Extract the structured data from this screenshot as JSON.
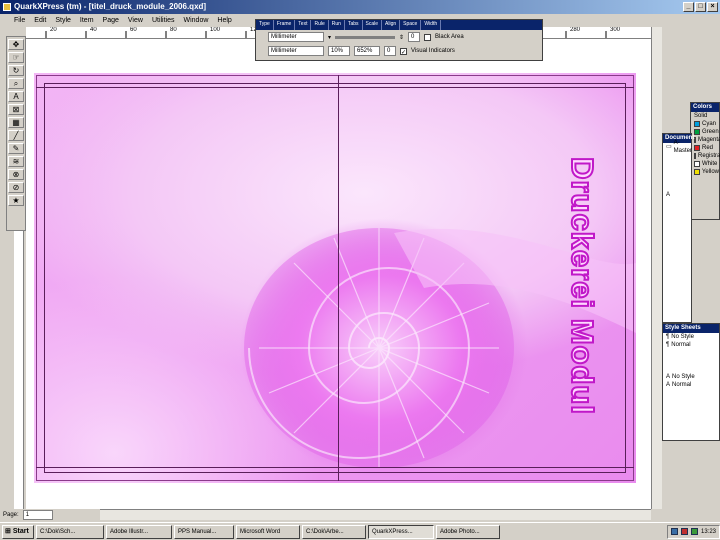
{
  "window": {
    "title": "QuarkXPress (tm) - [titel_druck_module_2006.qxd]"
  },
  "menubar": [
    "File",
    "Edit",
    "Style",
    "Item",
    "Page",
    "View",
    "Utilities",
    "Window",
    "Help"
  ],
  "ruler": {
    "ticks": [
      "20",
      "40",
      "60",
      "80",
      "100",
      "120",
      "140",
      "160",
      "180",
      "200",
      "220",
      "240",
      "260",
      "280",
      "300"
    ]
  },
  "measurements": {
    "tabs": [
      "Type",
      "Frame",
      "Text",
      "Rule",
      "Run",
      "Tabs",
      "Scale",
      "Align",
      "Space",
      "Width"
    ],
    "row1": {
      "unit_a": "Millimeter",
      "check_a_label": "Black Area",
      "value_b": "0"
    },
    "row2": {
      "unit_b": "Millimeter",
      "zoom_a": "10%",
      "zoom_b": "652%",
      "value_c": "0",
      "check_b_label": "Visual Indicators"
    }
  },
  "document": {
    "vertical_text": "Druckerei Modul"
  },
  "status": {
    "page_label": "Page:",
    "page_value": "1"
  },
  "colors_palette": {
    "title": "Colors",
    "mode": "Solid",
    "items": [
      {
        "name": "Cyan",
        "color": "#00a0e0"
      },
      {
        "name": "Green",
        "color": "#00a040"
      },
      {
        "name": "Magenta",
        "color": "#d0108a"
      },
      {
        "name": "Red",
        "color": "#e02020"
      },
      {
        "name": "Registration",
        "color": "#000000"
      },
      {
        "name": "White",
        "color": "#ffffff"
      },
      {
        "name": "Yellow",
        "color": "#f0e000"
      }
    ]
  },
  "document_layout": {
    "title": "Document Layout",
    "page_a": "A",
    "master_label": "A-Master"
  },
  "stylesheets": {
    "title": "Style Sheets",
    "paragraph": [
      "No Style",
      "Normal"
    ],
    "character": [
      "No Style",
      "Normal"
    ]
  },
  "taskbar": {
    "start": "Start",
    "tasks": [
      "C:\\Dok\\Sch...",
      "Adobe Illustr...",
      "PPS Manual...",
      "Microsoft Word",
      "C:\\Dok\\Arbe...",
      "QuarkXPress...",
      "Adobe Photo..."
    ],
    "clock": "13:23"
  },
  "theme": {
    "page_pink": "#ee9ef2",
    "accent": "#c018c8",
    "titlebar": "#0a246a"
  }
}
